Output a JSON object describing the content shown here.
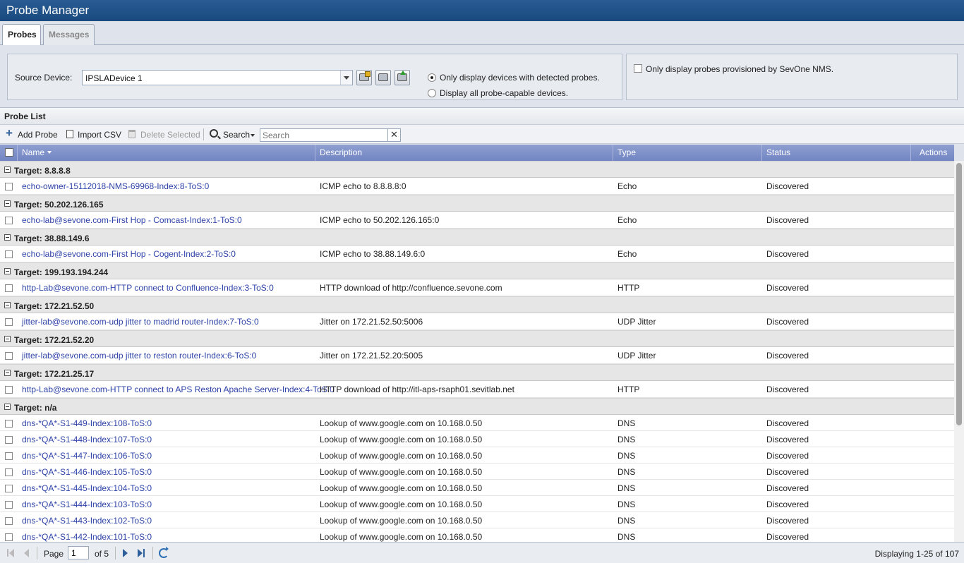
{
  "app": {
    "title": "Probe Manager"
  },
  "tabs": [
    {
      "label": "Probes",
      "active": true
    },
    {
      "label": "Messages",
      "active": false
    }
  ],
  "filter": {
    "source_label": "Source Device:",
    "source_value": "IPSLADevice 1",
    "buttons": [
      "device-edit-icon",
      "device-icon",
      "device-upload-icon"
    ],
    "radio_detected": "Only display devices with detected probes.",
    "radio_all": "Display all probe-capable devices.",
    "only_sevone": "Only display probes provisioned by SevOne NMS."
  },
  "probe_list": {
    "title": "Probe List",
    "toolbar": {
      "add": "Add Probe",
      "import": "Import CSV",
      "delete": "Delete Selected",
      "search_label": "Search",
      "search_placeholder": "Search",
      "clear": "✕"
    },
    "columns": [
      "Name",
      "Description",
      "Type",
      "Status",
      "Actions"
    ],
    "groups": [
      {
        "title": "Target: 8.8.8.8",
        "rows": [
          {
            "name": "echo-owner-15112018-NMS-69968-Index:8-ToS:0",
            "description": "ICMP echo to 8.8.8.8:0",
            "type": "Echo",
            "status": "Discovered"
          }
        ]
      },
      {
        "title": "Target: 50.202.126.165",
        "rows": [
          {
            "name": "echo-lab@sevone.com-First Hop - Comcast-Index:1-ToS:0",
            "description": "ICMP echo to 50.202.126.165:0",
            "type": "Echo",
            "status": "Discovered"
          }
        ]
      },
      {
        "title": "Target: 38.88.149.6",
        "rows": [
          {
            "name": "echo-lab@sevone.com-First Hop - Cogent-Index:2-ToS:0",
            "description": "ICMP echo to 38.88.149.6:0",
            "type": "Echo",
            "status": "Discovered"
          }
        ]
      },
      {
        "title": "Target: 199.193.194.244",
        "rows": [
          {
            "name": "http-Lab@sevone.com-HTTP connect to Confluence-Index:3-ToS:0",
            "description": "HTTP download of http://confluence.sevone.com",
            "type": "HTTP",
            "status": "Discovered"
          }
        ]
      },
      {
        "title": "Target: 172.21.52.50",
        "rows": [
          {
            "name": "jitter-lab@sevone.com-udp jitter to madrid router-Index:7-ToS:0",
            "description": "Jitter on 172.21.52.50:5006",
            "type": "UDP Jitter",
            "status": "Discovered"
          }
        ]
      },
      {
        "title": "Target: 172.21.52.20",
        "rows": [
          {
            "name": "jitter-lab@sevone.com-udp jitter to reston router-Index:6-ToS:0",
            "description": "Jitter on 172.21.52.20:5005",
            "type": "UDP Jitter",
            "status": "Discovered"
          }
        ]
      },
      {
        "title": "Target: 172.21.25.17",
        "rows": [
          {
            "name": "http-Lab@sevone.com-HTTP connect to APS Reston Apache Server-Index:4-ToS:0",
            "description": "HTTP download of http://itl-aps-rsaph01.sevitlab.net",
            "type": "HTTP",
            "status": "Discovered"
          }
        ]
      },
      {
        "title": "Target: n/a",
        "rows": [
          {
            "name": "dns-*QA*-S1-449-Index:108-ToS:0",
            "description": "Lookup of www.google.com on 10.168.0.50",
            "type": "DNS",
            "status": "Discovered"
          },
          {
            "name": "dns-*QA*-S1-448-Index:107-ToS:0",
            "description": "Lookup of www.google.com on 10.168.0.50",
            "type": "DNS",
            "status": "Discovered"
          },
          {
            "name": "dns-*QA*-S1-447-Index:106-ToS:0",
            "description": "Lookup of www.google.com on 10.168.0.50",
            "type": "DNS",
            "status": "Discovered"
          },
          {
            "name": "dns-*QA*-S1-446-Index:105-ToS:0",
            "description": "Lookup of www.google.com on 10.168.0.50",
            "type": "DNS",
            "status": "Discovered"
          },
          {
            "name": "dns-*QA*-S1-445-Index:104-ToS:0",
            "description": "Lookup of www.google.com on 10.168.0.50",
            "type": "DNS",
            "status": "Discovered"
          },
          {
            "name": "dns-*QA*-S1-444-Index:103-ToS:0",
            "description": "Lookup of www.google.com on 10.168.0.50",
            "type": "DNS",
            "status": "Discovered"
          },
          {
            "name": "dns-*QA*-S1-443-Index:102-ToS:0",
            "description": "Lookup of www.google.com on 10.168.0.50",
            "type": "DNS",
            "status": "Discovered"
          },
          {
            "name": "dns-*QA*-S1-442-Index:101-ToS:0",
            "description": "Lookup of www.google.com on 10.168.0.50",
            "type": "DNS",
            "status": "Discovered"
          }
        ]
      }
    ]
  },
  "pager": {
    "page_label": "Page",
    "page_value": "1",
    "of_label": "of 5",
    "displaying": "Displaying 1-25 of 107"
  }
}
